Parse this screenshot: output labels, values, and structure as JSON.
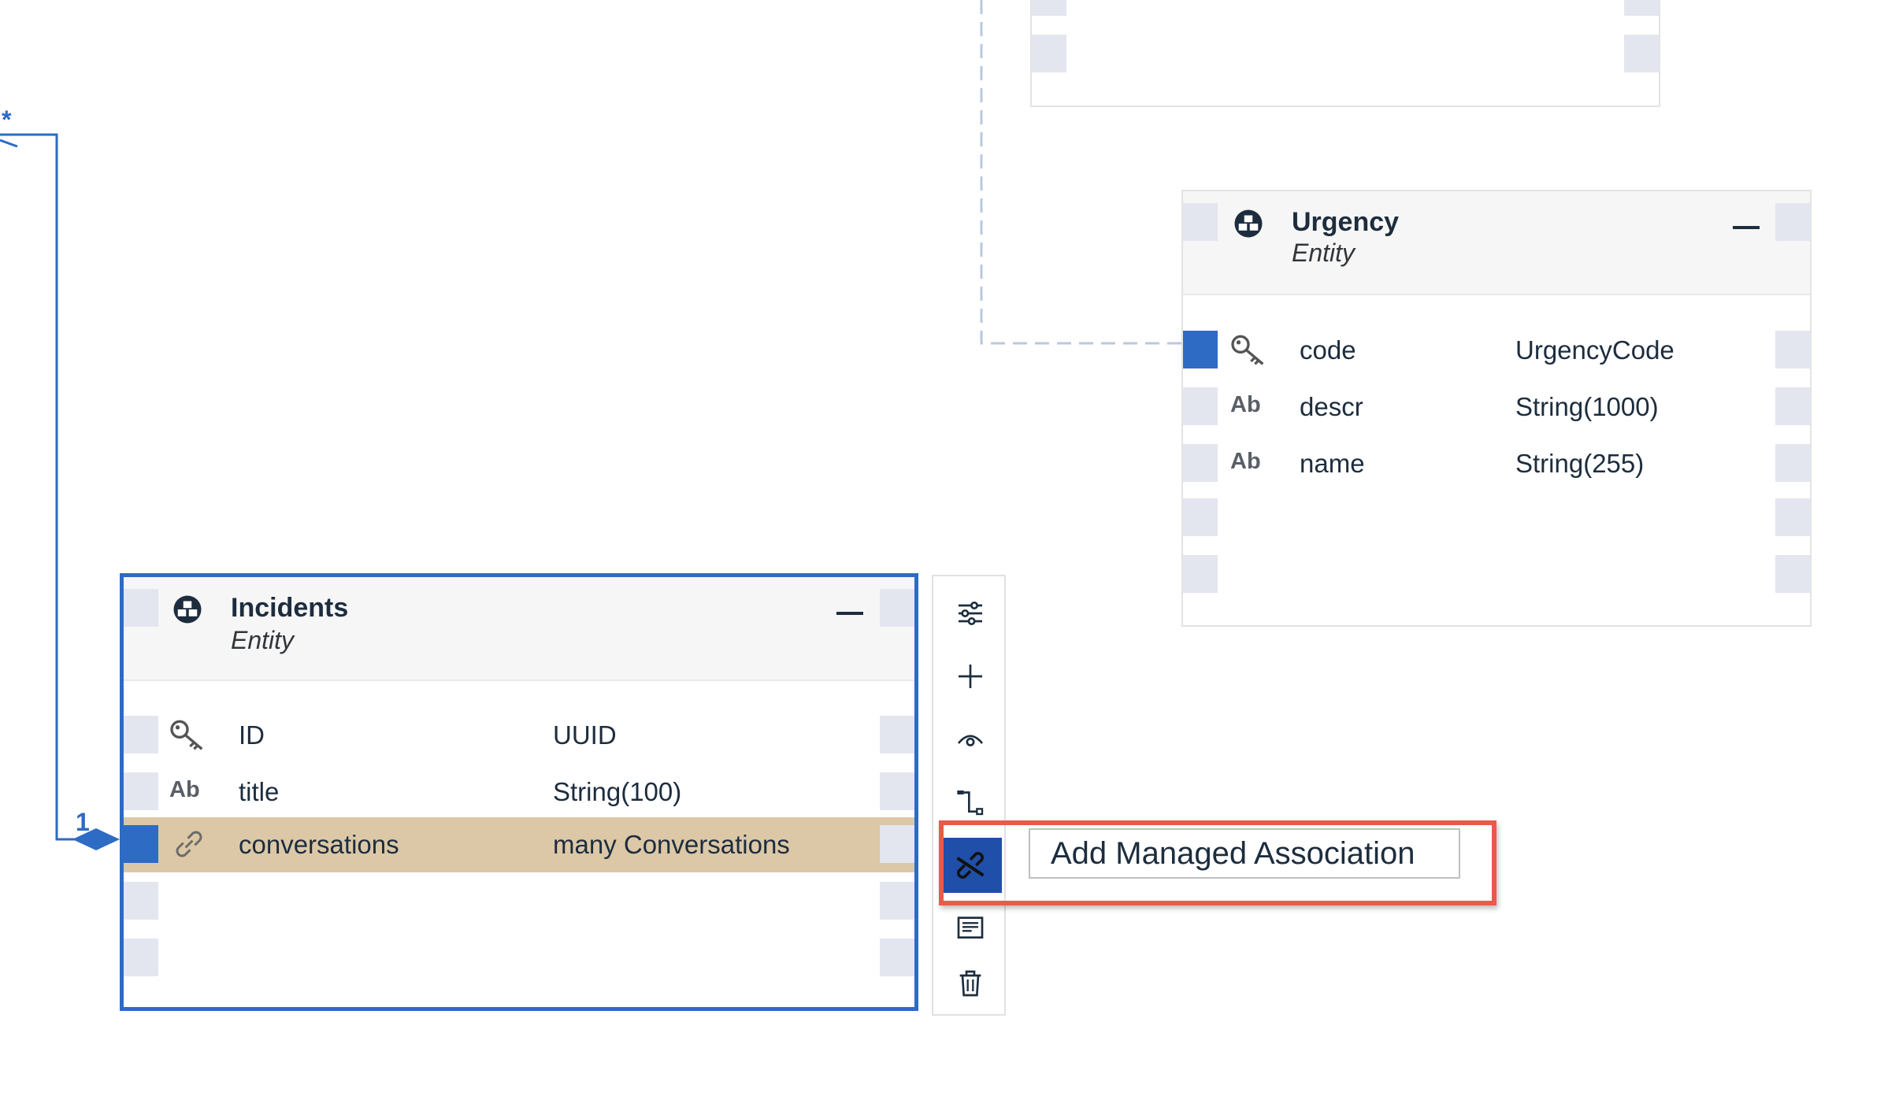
{
  "entities": {
    "urgency": {
      "name": "Urgency",
      "kind": "Entity",
      "fields": [
        {
          "icon": "key-icon",
          "name": "code",
          "type": "UrgencyCode"
        },
        {
          "icon": "Ab",
          "name": "descr",
          "type": "String(1000)"
        },
        {
          "icon": "Ab",
          "name": "name",
          "type": "String(255)"
        }
      ]
    },
    "incidents": {
      "name": "Incidents",
      "kind": "Entity",
      "fields": [
        {
          "icon": "key-icon",
          "name": "ID",
          "type": "UUID"
        },
        {
          "icon": "Ab",
          "name": "title",
          "type": "String(100)"
        },
        {
          "icon": "link-icon",
          "name": "conversations",
          "type": "many Conversations"
        }
      ]
    }
  },
  "links": {
    "left_cardinality_top": "*",
    "left_cardinality_bottom": "1"
  },
  "toolbar": {
    "buttons": [
      "settings-sliders-icon",
      "add-icon",
      "eye-icon",
      "connector-icon",
      "managed-association-icon",
      "notes-icon",
      "delete-icon"
    ],
    "active": "managed-association-icon"
  },
  "tooltip": {
    "text": "Add Managed Association"
  },
  "colors": {
    "accent": "#2e6bc4",
    "highlight_row": "#dcc8a6",
    "annotation": "#ea5a4c",
    "active_button": "#1f4fa8"
  }
}
